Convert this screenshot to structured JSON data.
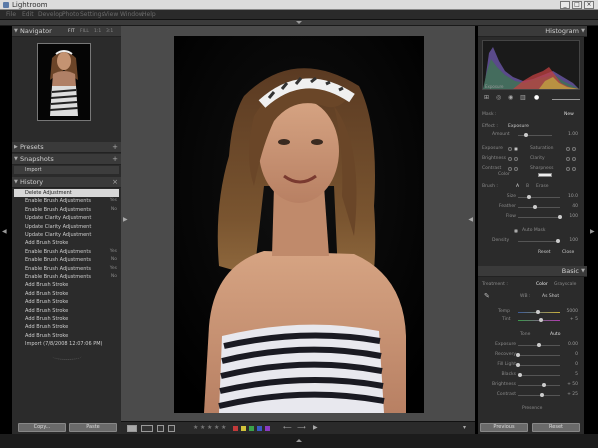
{
  "window": {
    "title": "Lightroom"
  },
  "menu": [
    "File",
    "Edit",
    "Develop",
    "Photo",
    "Settings",
    "View",
    "Window",
    "Help"
  ],
  "left": {
    "navigator": {
      "title": "Navigator",
      "zoom": [
        "FIT",
        "FILL",
        "1:1",
        "3:1"
      ]
    },
    "presets": {
      "title": "Presets"
    },
    "snapshots": {
      "title": "Snapshots",
      "items": [
        "Import"
      ]
    },
    "history": {
      "title": "History",
      "items": [
        {
          "label": "Delete Adjustment",
          "key": ""
        },
        {
          "label": "Enable Brush Adjustments",
          "key": "Yes"
        },
        {
          "label": "Enable Brush Adjustments",
          "key": "No"
        },
        {
          "label": "Update Clarity Adjustment",
          "key": ""
        },
        {
          "label": "Update Clarity Adjustment",
          "key": ""
        },
        {
          "label": "Update Clarity Adjustment",
          "key": ""
        },
        {
          "label": "Add Brush Stroke",
          "key": ""
        },
        {
          "label": "Enable Brush Adjustments",
          "key": "Yes"
        },
        {
          "label": "Enable Brush Adjustments",
          "key": "No"
        },
        {
          "label": "Enable Brush Adjustments",
          "key": "Yes"
        },
        {
          "label": "Enable Brush Adjustments",
          "key": "No"
        },
        {
          "label": "Add Brush Stroke",
          "key": ""
        },
        {
          "label": "Add Brush Stroke",
          "key": ""
        },
        {
          "label": "Add Brush Stroke",
          "key": ""
        },
        {
          "label": "Add Brush Stroke",
          "key": ""
        },
        {
          "label": "Add Brush Stroke",
          "key": ""
        },
        {
          "label": "Add Brush Stroke",
          "key": ""
        },
        {
          "label": "Add Brush Stroke",
          "key": ""
        },
        {
          "label": "Import (7/8/2008 12:07:06 PM)",
          "key": ""
        }
      ]
    },
    "buttons": {
      "copy": "Copy...",
      "paste": "Paste"
    }
  },
  "right": {
    "histogram": {
      "title": "Histogram",
      "readout": "Exposure"
    },
    "brush": {
      "mask_label": "Mask :",
      "mask_new": "New",
      "effect_label": "Effect :",
      "effect_value": "Exposure",
      "amount_label": "Amount",
      "amount_value": "1.00",
      "params": [
        {
          "a": "Exposure",
          "b": "Saturation"
        },
        {
          "a": "Brightness",
          "b": "Clarity"
        },
        {
          "a": "Contrast",
          "b": "Sharpness"
        }
      ],
      "color_label": "Color",
      "brush_label": "Brush :",
      "brush_a": "A",
      "brush_b": "B",
      "brush_erase": "Erase",
      "sliders": [
        {
          "label": "Size",
          "value": "10.0",
          "pos": 0.25
        },
        {
          "label": "Feather",
          "value": "40",
          "pos": 0.4
        },
        {
          "label": "Flow",
          "value": "100",
          "pos": 1.0
        }
      ],
      "automask": "Auto Mask",
      "density": {
        "label": "Density",
        "value": "100",
        "pos": 1.0
      },
      "reset": "Reset",
      "close": "Close"
    },
    "basic": {
      "title": "Basic",
      "treatment_label": "Treatment :",
      "color": "Color",
      "grayscale": "Grayscale",
      "wb_label": "WB :",
      "wb_value": "As Shot",
      "temp": {
        "label": "Temp",
        "value": "5000",
        "pos": 0.48
      },
      "tint": {
        "label": "Tint",
        "value": "+ 5",
        "pos": 0.52
      },
      "tone": "Tone",
      "auto": "Auto",
      "tone_sliders": [
        {
          "label": "Exposure",
          "value": "0.00",
          "pos": 0.5
        },
        {
          "label": "Recovery",
          "value": "0",
          "pos": 0.0
        },
        {
          "label": "Fill Light",
          "value": "0",
          "pos": 0.0
        },
        {
          "label": "Blacks",
          "value": "5",
          "pos": 0.05
        },
        {
          "label": "Brightness",
          "value": "+ 50",
          "pos": 0.62
        },
        {
          "label": "Contrast",
          "value": "+ 25",
          "pos": 0.56
        }
      ],
      "presence": "Presence"
    },
    "buttons": {
      "previous": "Previous",
      "reset": "Reset"
    }
  },
  "colors": {
    "panel": "#2b2b2b",
    "center": "#4b4b4b",
    "selected": "#d8d8d8"
  }
}
